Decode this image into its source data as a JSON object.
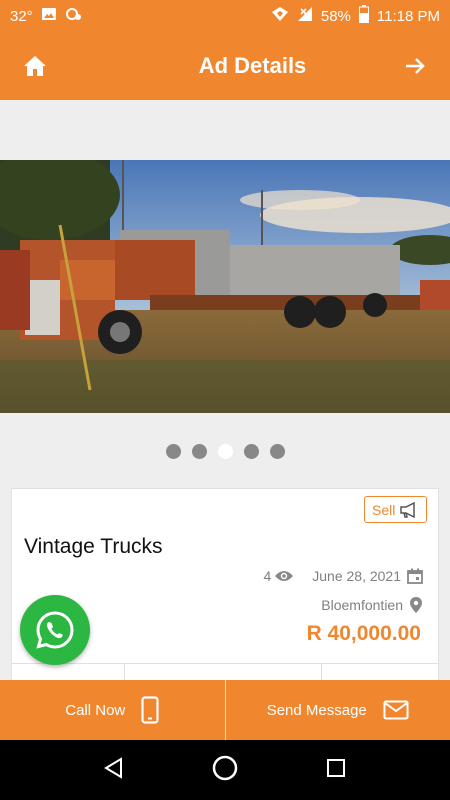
{
  "status": {
    "temperature": "32°",
    "battery": "58%",
    "time": "11:18 PM"
  },
  "header": {
    "title": "Ad Details"
  },
  "gallery": {
    "dot_count": 5,
    "active_index": 2
  },
  "ad": {
    "badge": "Sell",
    "title": "Vintage Trucks",
    "views": "4",
    "date": "June 28, 2021",
    "location": "Bloemfontien",
    "price": "R 40,000.00"
  },
  "actions": {
    "call_label": "Call Now",
    "message_label": "Send Message"
  },
  "colors": {
    "accent": "#f0872e",
    "whatsapp": "#2bb741"
  }
}
